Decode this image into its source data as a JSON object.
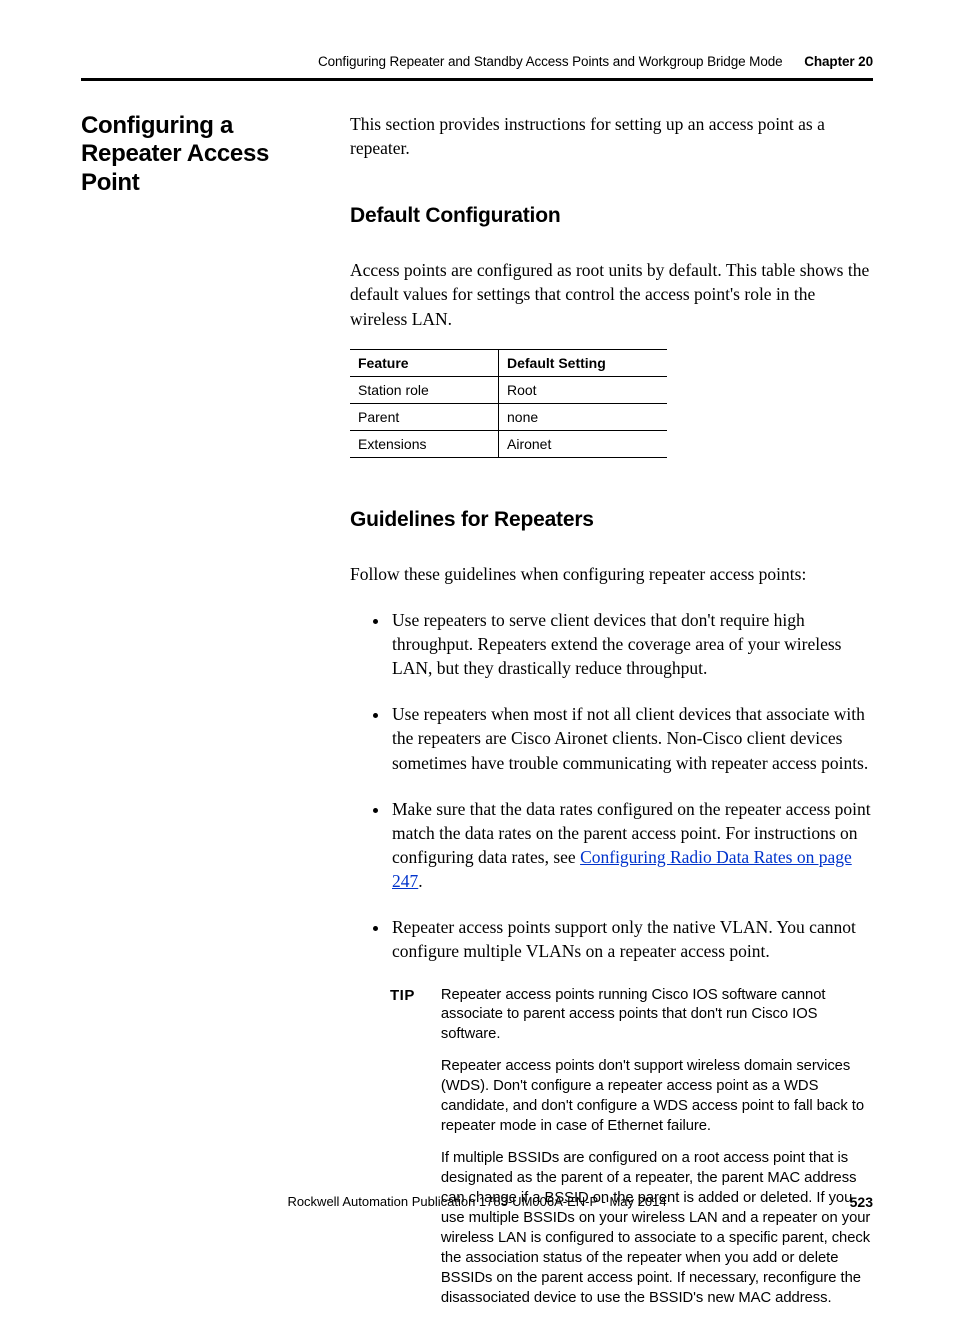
{
  "header": {
    "doc_title": "Configuring Repeater and Standby Access Points and Workgroup Bridge Mode",
    "chapter_label": "Chapter 20"
  },
  "side_heading": "Configuring a Repeater Access Point",
  "intro": "This section provides instructions for setting up an access point as a repeater.",
  "section_default": {
    "heading": "Default Configuration",
    "para": "Access points are configured as root units by default. This table shows the default values for settings that control the access point's role in the wireless LAN.",
    "table": {
      "headers": [
        "Feature",
        "Default Setting"
      ],
      "rows": [
        [
          "Station role",
          "Root"
        ],
        [
          "Parent",
          "none"
        ],
        [
          "Extensions",
          "Aironet"
        ]
      ]
    }
  },
  "section_guidelines": {
    "heading": "Guidelines for Repeaters",
    "intro": "Follow these guidelines when configuring repeater access points:",
    "bullets": [
      "Use repeaters to serve client devices that don't require high throughput. Repeaters extend the coverage area of your wireless LAN, but they drastically reduce throughput.",
      "Use repeaters when most if not all client devices that associate with the repeaters are Cisco Aironet clients. Non-Cisco client devices sometimes have trouble communicating with repeater access points.",
      {
        "pre": "Make sure that the data rates configured on the repeater access point match the data rates on the parent access point. For instructions on configuring data rates, see ",
        "link": "Configuring Radio Data Rates on page 247",
        "post": "."
      },
      "Repeater access points support only the native VLAN. You cannot configure multiple VLANs on a repeater access point."
    ],
    "tip": {
      "label": "TIP",
      "paras": [
        "Repeater access points running Cisco IOS software cannot associate to parent access points that don't run Cisco IOS software.",
        "Repeater access points don't support wireless domain services (WDS). Don't configure a repeater access point as a WDS candidate, and don't configure a WDS access point to fall back to repeater mode in case of Ethernet failure.",
        "If multiple BSSIDs are configured on a root access point that is designated as the parent of a repeater, the parent MAC address can change if a BSSID on the parent is added or deleted. If you use multiple BSSIDs on your wireless LAN and a repeater on your wireless LAN is configured to associate to a specific parent, check the association status of the repeater when you add or delete BSSIDs on the parent access point. If necessary, reconfigure the disassociated device to use the BSSID's new MAC address."
      ]
    }
  },
  "footer": {
    "publication": "Rockwell Automation Publication 1783-UM006A-EN-P - May 2014",
    "page": "523"
  }
}
